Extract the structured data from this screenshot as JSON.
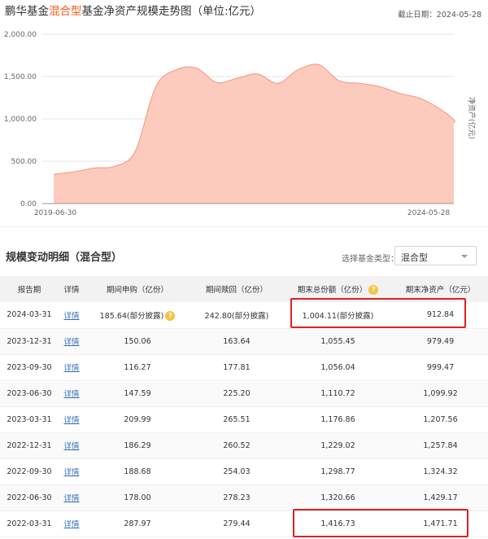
{
  "chart": {
    "title_prefix": "鹏华基金",
    "title_accent": "混合型",
    "title_suffix": "基金净资产规模走势图（单位:亿元）",
    "cutoff_date": "截止日期：2024-05-28",
    "series_label": "净资产(亿元)",
    "colors": {
      "accent": "#ff5a14",
      "fill": "#fbc2b2",
      "line": "#f5a08c",
      "highlight": "#e02020"
    }
  },
  "chart_data": {
    "type": "area",
    "x_start": "2019-06-30",
    "x_end": "2024-05-28",
    "ylim": [
      0,
      2000
    ],
    "yticks": [
      "2,000.00",
      "1,500.00",
      "1,000.00",
      "500.00",
      "0.00"
    ],
    "xticks": [
      "2019-06-30",
      "2024-05-28"
    ],
    "ylabel": "净资产(亿元)",
    "x": [
      "2019-06-30",
      "2019-09-30",
      "2019-12-31",
      "2020-03-31",
      "2020-06-30",
      "2020-09-30",
      "2020-12-31",
      "2021-03-31",
      "2021-06-30",
      "2021-09-30",
      "2021-12-31",
      "2022-03-31",
      "2022-06-30",
      "2022-09-30",
      "2022-12-31",
      "2023-03-31",
      "2023-06-30",
      "2023-09-30",
      "2023-12-31",
      "2024-03-31",
      "2024-05-28"
    ],
    "values": [
      345,
      375,
      420,
      440,
      620,
      1380,
      1580,
      1600,
      1430,
      1480,
      1530,
      1420,
      1580,
      1640,
      1450,
      1420,
      1380,
      1300,
      1240,
      1110,
      990,
      955
    ],
    "grid": true
  },
  "detail": {
    "title": "规模变动明细（混合型）",
    "filter_label": "选择基金类型：",
    "filter_value": "混合型",
    "columns": [
      "报告期",
      "详情",
      "期间申购（亿份）",
      "期间赎回（亿份）",
      "期末总份额（亿份）",
      "期末净资产（亿元）"
    ],
    "rows": [
      {
        "date": "2024-03-31",
        "detail": "详情",
        "subscribe": "185.64(部分披露)",
        "redeem": "242.80(部分披露)",
        "shares": "1,004.11(部分披露)",
        "nav": "912.84"
      },
      {
        "date": "2023-12-31",
        "detail": "详情",
        "subscribe": "150.06",
        "redeem": "163.64",
        "shares": "1,055.45",
        "nav": "979.49"
      },
      {
        "date": "2023-09-30",
        "detail": "详情",
        "subscribe": "116.27",
        "redeem": "177.81",
        "shares": "1,056.04",
        "nav": "999.47"
      },
      {
        "date": "2023-06-30",
        "detail": "详情",
        "subscribe": "147.59",
        "redeem": "225.20",
        "shares": "1,110.72",
        "nav": "1,099.92"
      },
      {
        "date": "2023-03-31",
        "detail": "详情",
        "subscribe": "209.99",
        "redeem": "265.51",
        "shares": "1,176.86",
        "nav": "1,207.56"
      },
      {
        "date": "2022-12-31",
        "detail": "详情",
        "subscribe": "186.29",
        "redeem": "260.52",
        "shares": "1,229.02",
        "nav": "1,257.84"
      },
      {
        "date": "2022-09-30",
        "detail": "详情",
        "subscribe": "188.68",
        "redeem": "254.03",
        "shares": "1,298.77",
        "nav": "1,324.32"
      },
      {
        "date": "2022-06-30",
        "detail": "详情",
        "subscribe": "178.00",
        "redeem": "278.23",
        "shares": "1,320.66",
        "nav": "1,429.17"
      },
      {
        "date": "2022-03-31",
        "detail": "详情",
        "subscribe": "287.97",
        "redeem": "279.44",
        "shares": "1,416.73",
        "nav": "1,471.71"
      }
    ]
  }
}
